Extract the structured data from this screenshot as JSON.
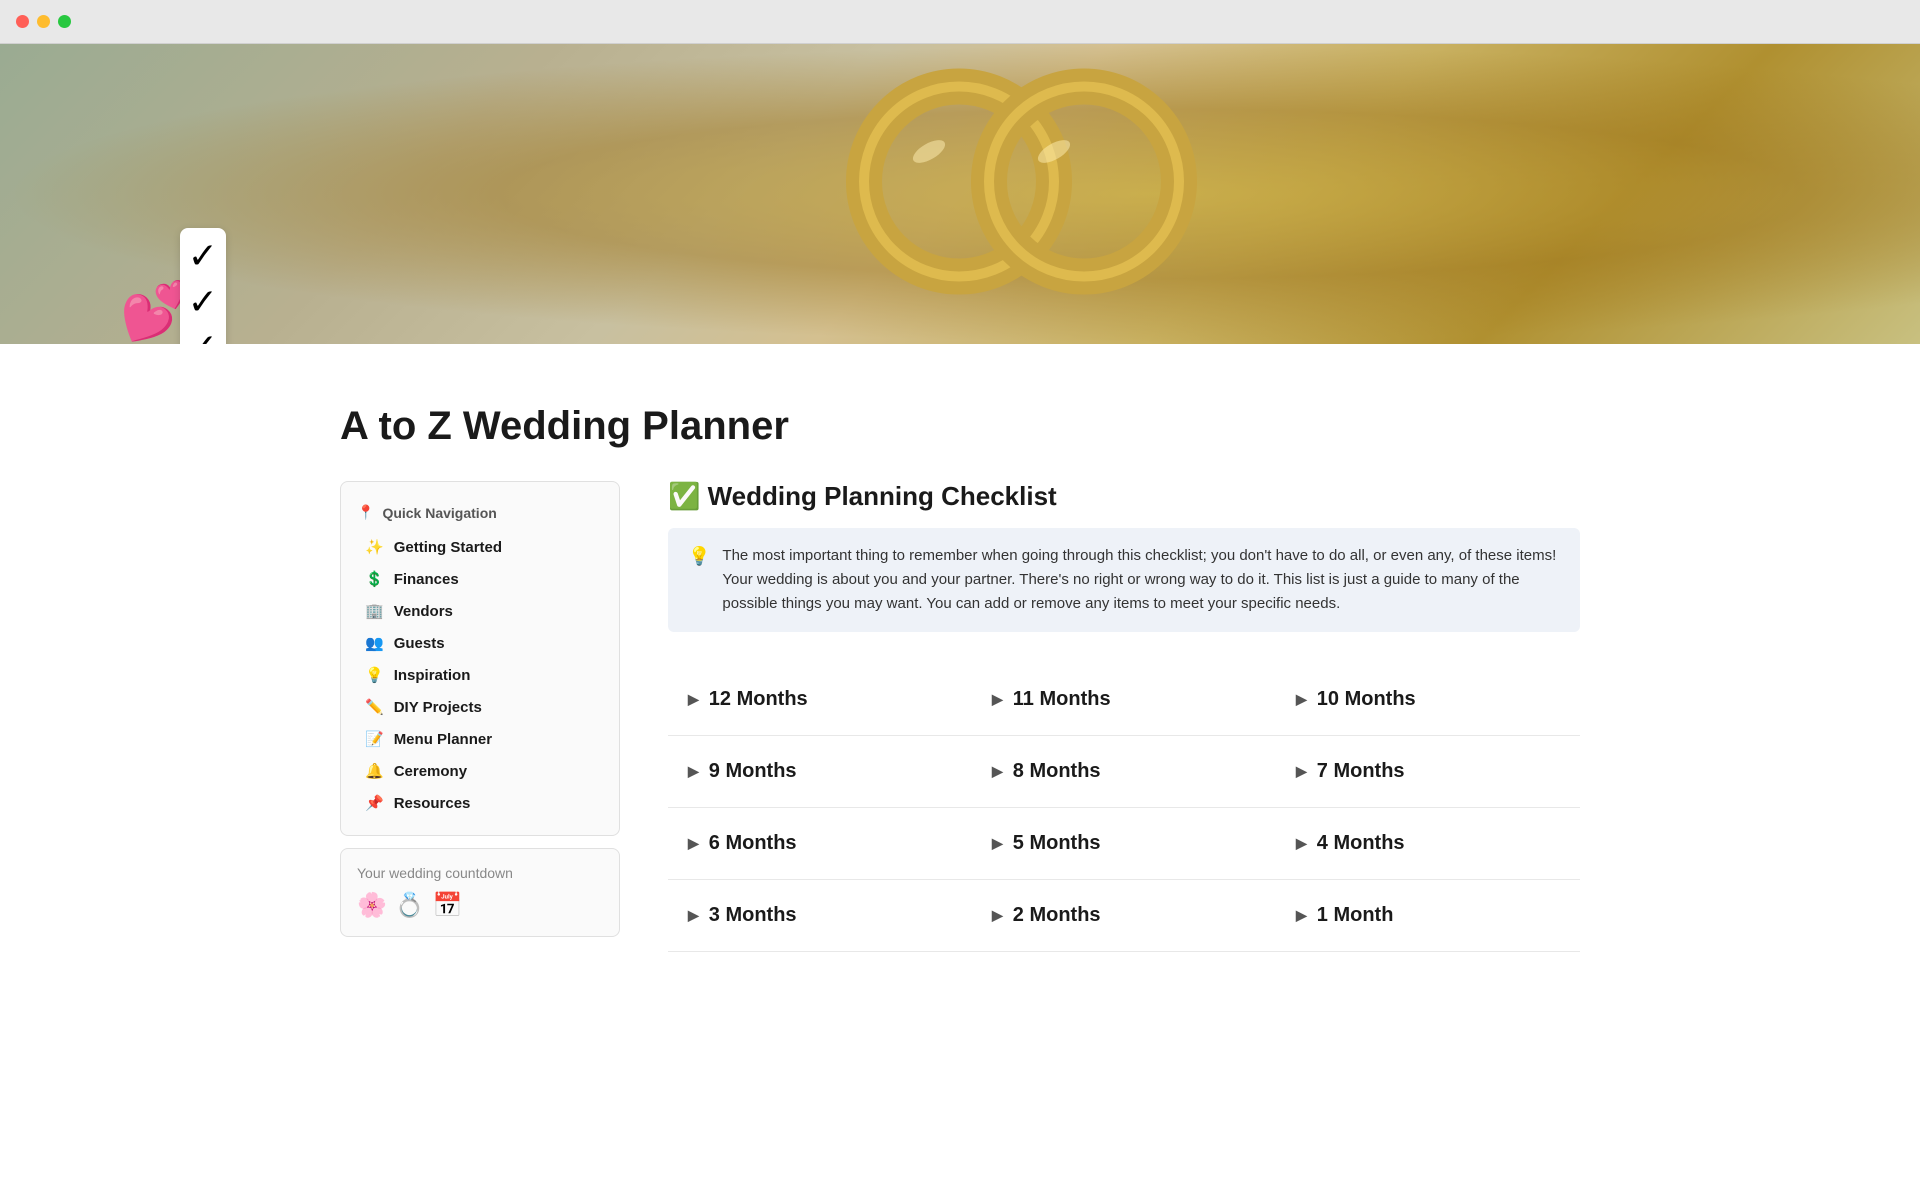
{
  "browser": {
    "traffic_lights": [
      "red",
      "yellow",
      "green"
    ]
  },
  "page": {
    "title": "A to Z Wedding Planner",
    "icon_emoji": "💕📋"
  },
  "sidebar": {
    "nav_title": "Quick Navigation",
    "nav_icon": "📍",
    "items": [
      {
        "label": "Getting Started",
        "icon": "✨"
      },
      {
        "label": "Finances",
        "icon": "💲"
      },
      {
        "label": "Vendors",
        "icon": "🏢"
      },
      {
        "label": "Guests",
        "icon": "👥"
      },
      {
        "label": "Inspiration",
        "icon": "💡"
      },
      {
        "label": "DIY Projects",
        "icon": "✏️"
      },
      {
        "label": "Menu Planner",
        "icon": "📝"
      },
      {
        "label": "Ceremony",
        "icon": "🔔"
      },
      {
        "label": "Resources",
        "icon": "📌"
      }
    ],
    "countdown_title": "Your wedding countdown"
  },
  "main": {
    "section_title": "✅ Wedding Planning Checklist",
    "info_text": "The most important thing to remember when going through this checklist; you don't have to do all, or even any, of these items! Your wedding is about you and your partner. There's no right or wrong way to do it. This list is just a guide to many of the possible things you may want. You can add or remove any items to meet your specific needs.",
    "info_icon": "💡",
    "checklist_items": [
      {
        "label": "12 Months",
        "col": 1,
        "row": 1
      },
      {
        "label": "11 Months",
        "col": 2,
        "row": 1
      },
      {
        "label": "10 Months",
        "col": 3,
        "row": 1
      },
      {
        "label": "9 Months",
        "col": 1,
        "row": 2
      },
      {
        "label": "8 Months",
        "col": 2,
        "row": 2
      },
      {
        "label": "7 Months",
        "col": 3,
        "row": 2
      },
      {
        "label": "6 Months",
        "col": 1,
        "row": 3
      },
      {
        "label": "5 Months",
        "col": 2,
        "row": 3
      },
      {
        "label": "4 Months",
        "col": 3,
        "row": 3
      },
      {
        "label": "3 Months",
        "col": 1,
        "row": 4
      },
      {
        "label": "2 Months",
        "col": 2,
        "row": 4
      },
      {
        "label": "1 Month",
        "col": 3,
        "row": 4
      }
    ]
  }
}
